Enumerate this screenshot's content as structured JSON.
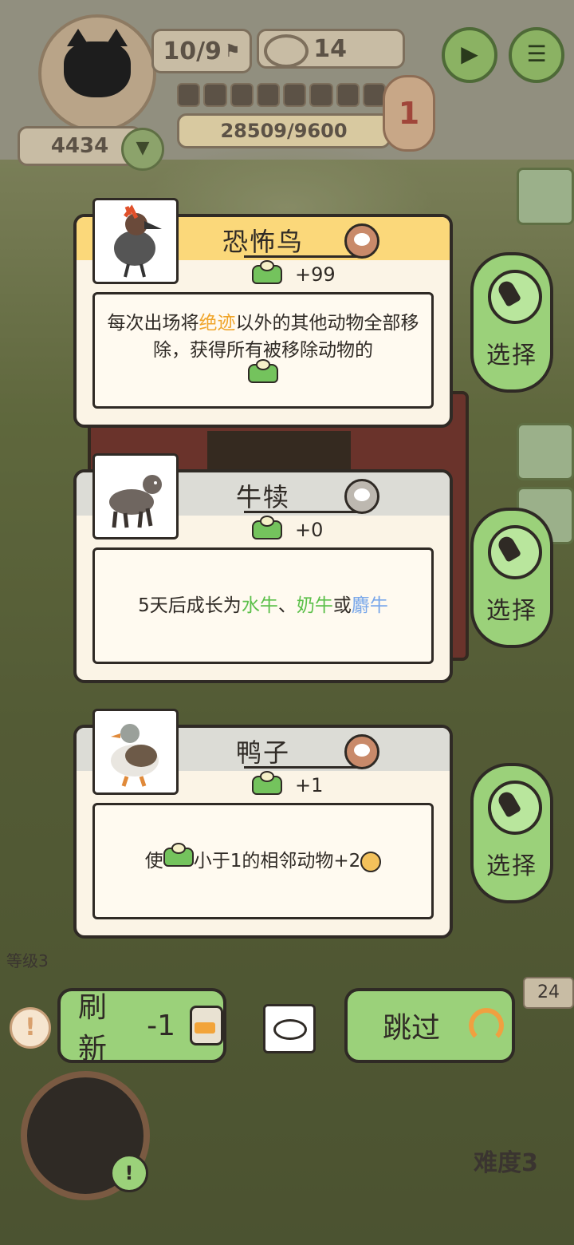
{
  "hud": {
    "day": "10/9",
    "cans": "14",
    "score": "4434",
    "progress_segments": 8,
    "xp": "28509/9600",
    "stage_badge": "1"
  },
  "cards": [
    {
      "name": "恐怖鸟",
      "bonus": "+99",
      "desc_parts": [
        "每次出场将",
        "绝迹",
        "以外的其他动物全部移除，获得所有被移除动物的"
      ],
      "header_color": "#fbd87a",
      "rarity_color": "#c98a6a",
      "select_label": "选择"
    },
    {
      "name": "牛犊",
      "bonus": "+0",
      "desc_parts": [
        "5天后成长为",
        "水牛",
        "、",
        "奶牛",
        "或",
        "麝牛"
      ],
      "header_color": "#dcdcd6",
      "rarity_color": "#bdb8b0",
      "select_label": "选择"
    },
    {
      "name": "鸭子",
      "bonus": "+1",
      "desc_parts": [
        "使",
        "小于1的相邻动物+2"
      ],
      "header_color": "#dcdcd6",
      "rarity_color": "#c98a6a",
      "select_label": "选择"
    }
  ],
  "bottom": {
    "refresh_label": "刷新",
    "refresh_cost": "-1",
    "skip_label": "跳过",
    "level": "等级3",
    "side_count": "24",
    "difficulty": "难度3"
  }
}
